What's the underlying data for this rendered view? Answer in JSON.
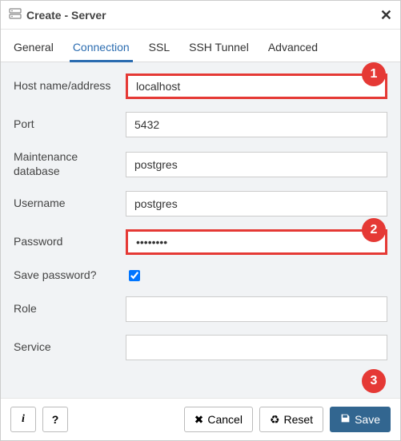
{
  "title": "Create - Server",
  "tabs": [
    "General",
    "Connection",
    "SSL",
    "SSH Tunnel",
    "Advanced"
  ],
  "active_tab_index": 1,
  "fields": {
    "host": {
      "label": "Host name/address",
      "value": "localhost"
    },
    "port": {
      "label": "Port",
      "value": "5432"
    },
    "maintdb": {
      "label": "Maintenance database",
      "value": "postgres"
    },
    "username": {
      "label": "Username",
      "value": "postgres"
    },
    "password": {
      "label": "Password",
      "value": "••••••••"
    },
    "savepw": {
      "label": "Save password?",
      "checked": true
    },
    "role": {
      "label": "Role",
      "value": ""
    },
    "service": {
      "label": "Service",
      "value": ""
    }
  },
  "annotations": {
    "1": "1",
    "2": "2",
    "3": "3"
  },
  "footer": {
    "info_char": "i",
    "help_char": "?",
    "cancel": "Cancel",
    "reset": "Reset",
    "save": "Save"
  }
}
